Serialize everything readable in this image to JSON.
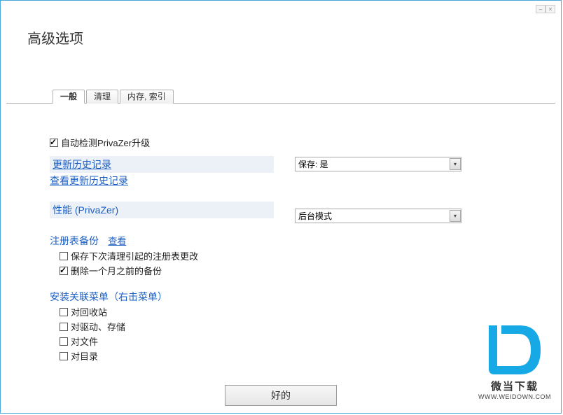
{
  "title": "高级选项",
  "tabs": {
    "general": "一般",
    "cleanup": "清理",
    "memory": "内存, 索引"
  },
  "auto_detect": {
    "label": "自动检测PrivaZer升级",
    "checked": true
  },
  "history": {
    "update_label": "更新历史记录",
    "view_label": "查看更新历史记录",
    "dropdown_value": "保存: 是"
  },
  "performance": {
    "label": "性能 (PrivaZer)",
    "dropdown_value": "后台模式"
  },
  "registry": {
    "header": "注册表备份",
    "view": "查看",
    "save_next": {
      "label": "保存下次清理引起的注册表更改",
      "checked": false
    },
    "delete_old": {
      "label": "删除一个月之前的备份",
      "checked": true
    }
  },
  "context_menu": {
    "header": "安装关联菜单（右击菜单）",
    "recycle": {
      "label": "对回收站",
      "checked": false
    },
    "drive": {
      "label": "对驱动、存储",
      "checked": false
    },
    "file": {
      "label": "对文件",
      "checked": false
    },
    "folder": {
      "label": "对目录",
      "checked": false
    }
  },
  "ok_button": "好的",
  "watermark": {
    "brand": "微当下载",
    "url": "WWW.WEIDOWN.COM"
  }
}
